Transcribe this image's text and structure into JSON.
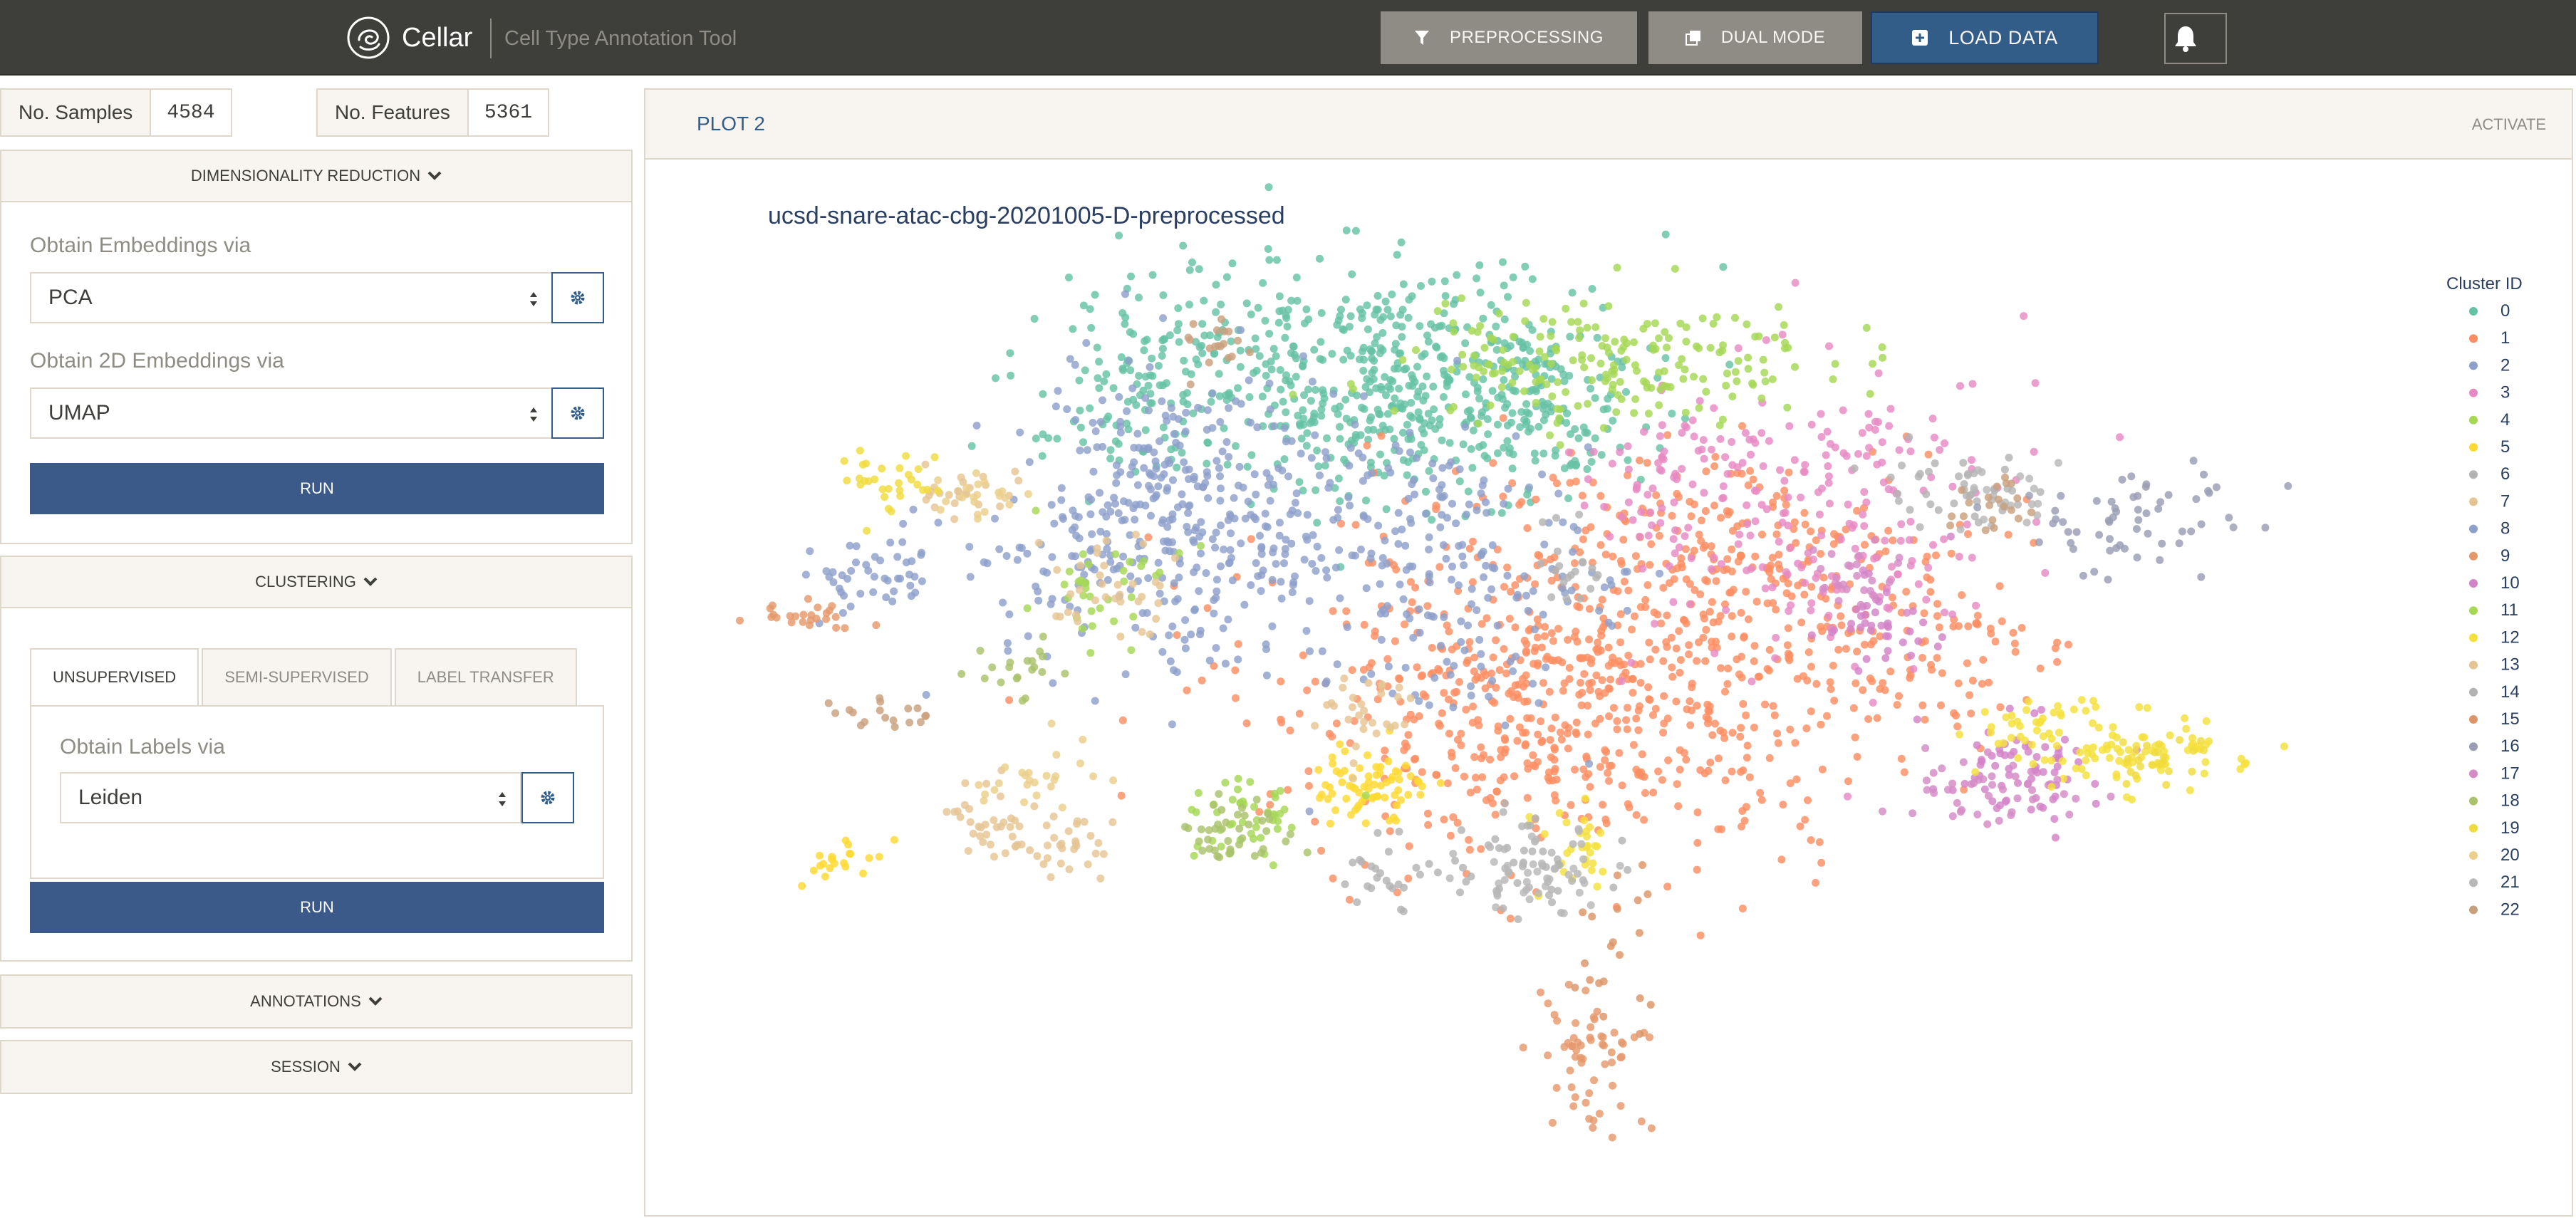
{
  "navbar": {
    "brand": "Cellar",
    "subtitle": "Cell Type Annotation Tool",
    "buttons": {
      "preprocessing": "Preprocessing",
      "dual_mode": "Dual Mode",
      "load_data": "Load Data"
    },
    "icons": [
      "cellar-logo-icon",
      "filter-icon",
      "copy-icon",
      "plus-square-icon",
      "bell-icon"
    ]
  },
  "stats": {
    "samples_label": "No. Samples",
    "samples_value": "4584",
    "features_label": "No. Features",
    "features_value": "5361"
  },
  "dim_reduction": {
    "header": "Dimensionality Reduction",
    "embed_label": "Obtain Embeddings via",
    "embed_value": "PCA",
    "embed2d_label": "Obtain 2D Embeddings via",
    "embed2d_value": "UMAP",
    "run_label": "Run"
  },
  "clustering": {
    "header": "Clustering",
    "tabs": [
      "Unsupervised",
      "Semi-Supervised",
      "Label Transfer"
    ],
    "active_tab": "Unsupervised",
    "labels_label": "Obtain Labels via",
    "labels_value": "Leiden",
    "run_label": "Run"
  },
  "annotations": {
    "header": "Annotations"
  },
  "session": {
    "header": "Session"
  },
  "plot": {
    "tab_title": "Plot 2",
    "activate_label": "Activate"
  },
  "chart_data": {
    "type": "scatter",
    "title": "ucsd-snare-atac-cbg-20201005-D-preprocessed",
    "legend_title": "Cluster ID",
    "legend_position": "right",
    "grid": false,
    "axes_visible": false,
    "series": [
      {
        "name": "0",
        "color": "#66c2a5"
      },
      {
        "name": "1",
        "color": "#fc8d62"
      },
      {
        "name": "2",
        "color": "#8da0cb"
      },
      {
        "name": "3",
        "color": "#e78ac3"
      },
      {
        "name": "4",
        "color": "#a6d854"
      },
      {
        "name": "5",
        "color": "#ffd92f"
      },
      {
        "name": "6",
        "color": "#b3b3b3"
      },
      {
        "name": "7",
        "color": "#e5c494"
      },
      {
        "name": "8",
        "color": "#8da0cb"
      },
      {
        "name": "9",
        "color": "#e5996b"
      },
      {
        "name": "10",
        "color": "#d383c8"
      },
      {
        "name": "11",
        "color": "#a6d854"
      },
      {
        "name": "12",
        "color": "#f4e03b"
      },
      {
        "name": "13",
        "color": "#e5c494"
      },
      {
        "name": "14",
        "color": "#b3b3b3"
      },
      {
        "name": "15",
        "color": "#dd9567"
      },
      {
        "name": "16",
        "color": "#9a9db3"
      },
      {
        "name": "17",
        "color": "#d48bc6"
      },
      {
        "name": "18",
        "color": "#a9c26b"
      },
      {
        "name": "19",
        "color": "#f0dc3c"
      },
      {
        "name": "20",
        "color": "#ecd08a"
      },
      {
        "name": "21",
        "color": "#b8b8b8"
      },
      {
        "name": "22",
        "color": "#c9a07e"
      }
    ]
  }
}
